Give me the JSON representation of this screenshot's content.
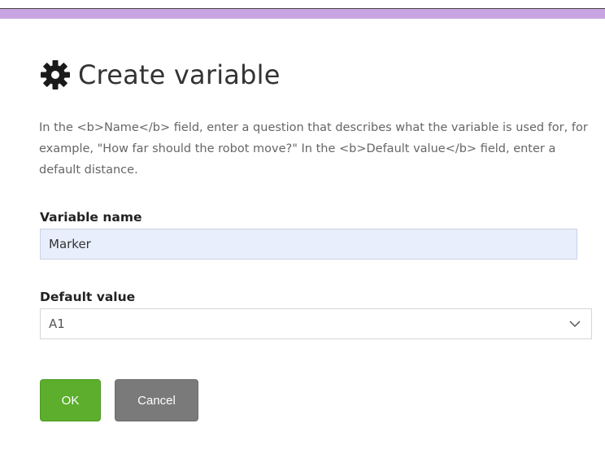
{
  "dialog": {
    "title": "Create variable",
    "title_icon": "gear-icon",
    "description": "In the <b>Name</b> field, enter a question that describes what the variable is used for, for example, \"How far should the robot move?\" In the <b>Default value</b> field, enter a default distance."
  },
  "form": {
    "variable_name_label": "Variable name",
    "variable_name_value": "Marker",
    "default_value_label": "Default value",
    "default_value_selected": "A1",
    "default_value_icon": "chevron-down-icon"
  },
  "buttons": {
    "ok_label": "OK",
    "cancel_label": "Cancel"
  },
  "colors": {
    "top_bar": "#c9a4e3",
    "ok_button": "#5cae2c",
    "cancel_button": "#7a7a7a",
    "input_background": "#e8eefb"
  }
}
